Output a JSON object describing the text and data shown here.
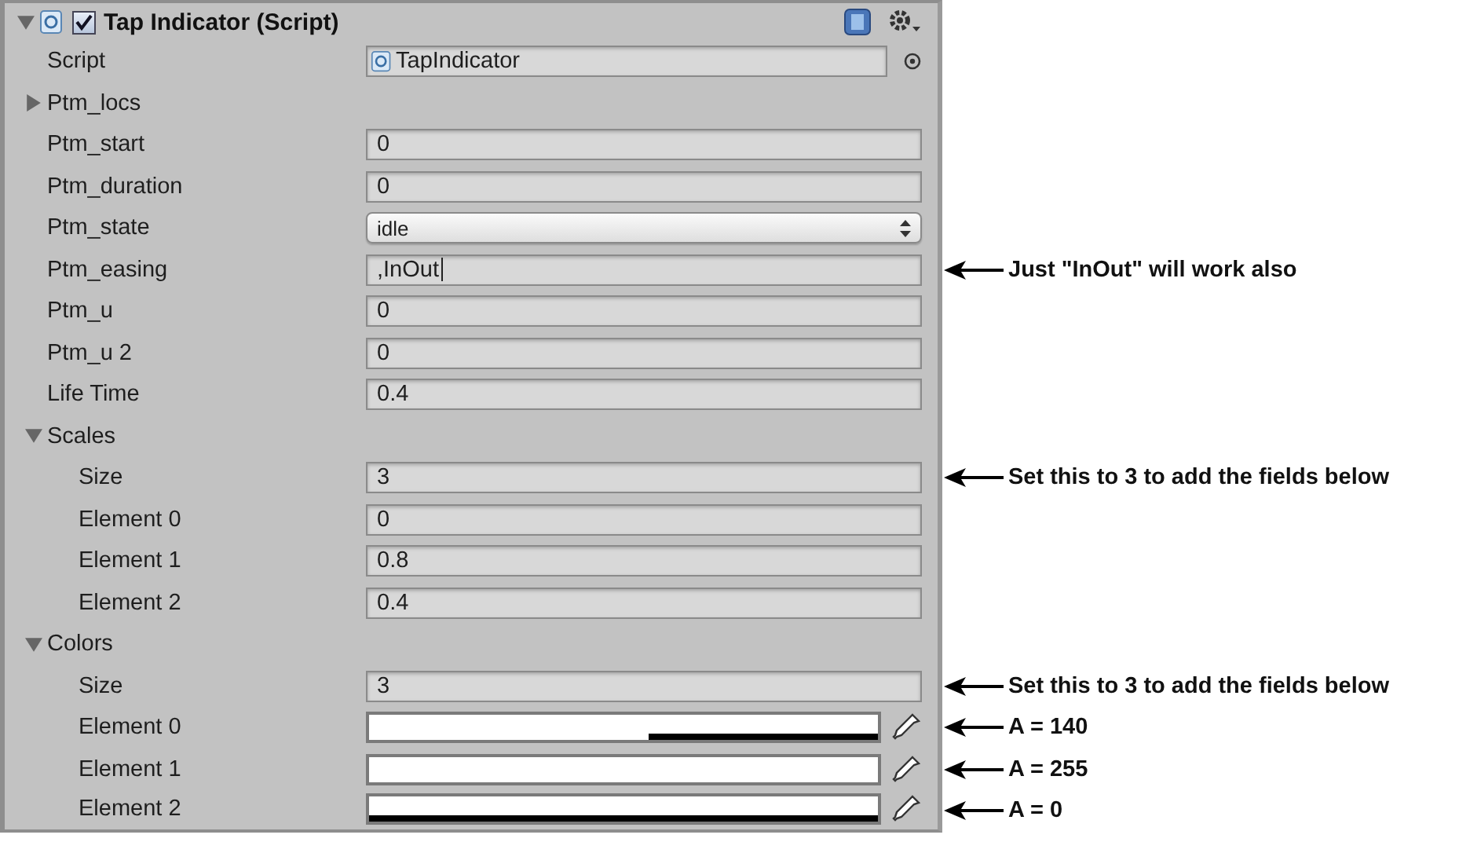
{
  "component": {
    "title": "Tap Indicator (Script)",
    "enabled": true,
    "expanded": true
  },
  "properties": [
    {
      "kind": "object",
      "label": "Script",
      "value": "TapIndicator"
    },
    {
      "kind": "foldout",
      "label": "Ptm_locs",
      "expanded": false
    },
    {
      "kind": "field",
      "label": "Ptm_start",
      "value": "0"
    },
    {
      "kind": "field",
      "label": "Ptm_duration",
      "value": "0"
    },
    {
      "kind": "dropdown",
      "label": "Ptm_state",
      "value": "idle"
    },
    {
      "kind": "field",
      "label": "Ptm_easing",
      "value": ",InOut",
      "focused": true,
      "note": "Just \"InOut\" will work also"
    },
    {
      "kind": "field",
      "label": "Ptm_u",
      "value": "0"
    },
    {
      "kind": "field",
      "label": "Ptm_u 2",
      "value": "0"
    },
    {
      "kind": "field",
      "label": "Life Time",
      "value": "0.4"
    },
    {
      "kind": "foldout",
      "label": "Scales",
      "expanded": true,
      "children": [
        {
          "kind": "field",
          "label": "Size",
          "value": "3",
          "note": "Set this to 3 to add the fields below"
        },
        {
          "kind": "field",
          "label": "Element 0",
          "value": "0"
        },
        {
          "kind": "field",
          "label": "Element 1",
          "value": "0.8"
        },
        {
          "kind": "field",
          "label": "Element 2",
          "value": "0.4"
        }
      ]
    },
    {
      "kind": "foldout",
      "label": "Colors",
      "expanded": true,
      "children": [
        {
          "kind": "field",
          "label": "Size",
          "value": "3",
          "note": "Set this to 3 to add the fields below"
        },
        {
          "kind": "color",
          "label": "Element 0",
          "level": 0.55,
          "note": "A = 140"
        },
        {
          "kind": "color",
          "label": "Element 1",
          "level": 1,
          "note": "A = 255"
        },
        {
          "kind": "color",
          "label": "Element 2",
          "level": 0,
          "note": "A = 0"
        }
      ]
    }
  ]
}
